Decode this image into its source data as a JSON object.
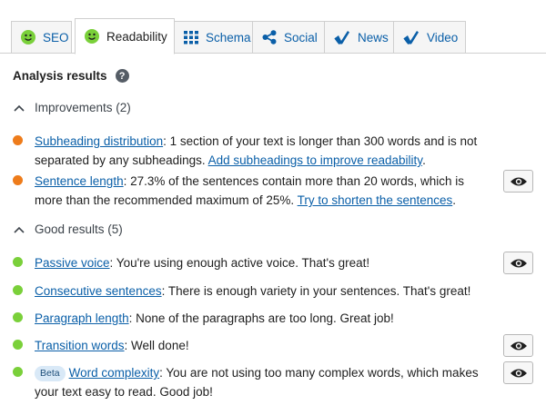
{
  "tabs": [
    {
      "label": "SEO",
      "icon": "smiley-icon"
    },
    {
      "label": "Readability",
      "icon": "smiley-icon"
    },
    {
      "label": "Schema",
      "icon": "grid-icon"
    },
    {
      "label": "Social",
      "icon": "share-icon"
    },
    {
      "label": "News",
      "icon": "yoast-icon"
    },
    {
      "label": "Video",
      "icon": "yoast-icon"
    }
  ],
  "active_tab": "Readability",
  "colors": {
    "good": "#7ad03a",
    "improvement": "#ee7c1b",
    "link": "#0a5fa8"
  },
  "analysis": {
    "title": "Analysis results",
    "help_symbol": "?",
    "improvements": {
      "label": "Improvements (2)",
      "items": [
        {
          "link": "Subheading distribution",
          "text": ": 1 section of your text is longer than 300 words and is not separated by any subheadings. ",
          "link2": "Add subheadings to improve readability",
          "tail": "."
        },
        {
          "link": "Sentence length",
          "text": ": 27.3% of the sentences contain more than 20 words, which is more than the recommended maximum of 25%. ",
          "link2": "Try to shorten the sentences",
          "tail": "."
        }
      ]
    },
    "good": {
      "label": "Good results (5)",
      "items": [
        {
          "link": "Passive voice",
          "text": ": You're using enough active voice. That's great!"
        },
        {
          "link": "Consecutive sentences",
          "text": ": There is enough variety in your sentences. That's great!"
        },
        {
          "link": "Paragraph length",
          "text": ": None of the paragraphs are too long. Great job!"
        },
        {
          "link": "Transition words",
          "text": ": Well done!"
        },
        {
          "badge": "Beta",
          "link": "Word complexity",
          "text": ": You are not using too many complex words, which makes your text easy to read. Good job!"
        }
      ]
    }
  }
}
